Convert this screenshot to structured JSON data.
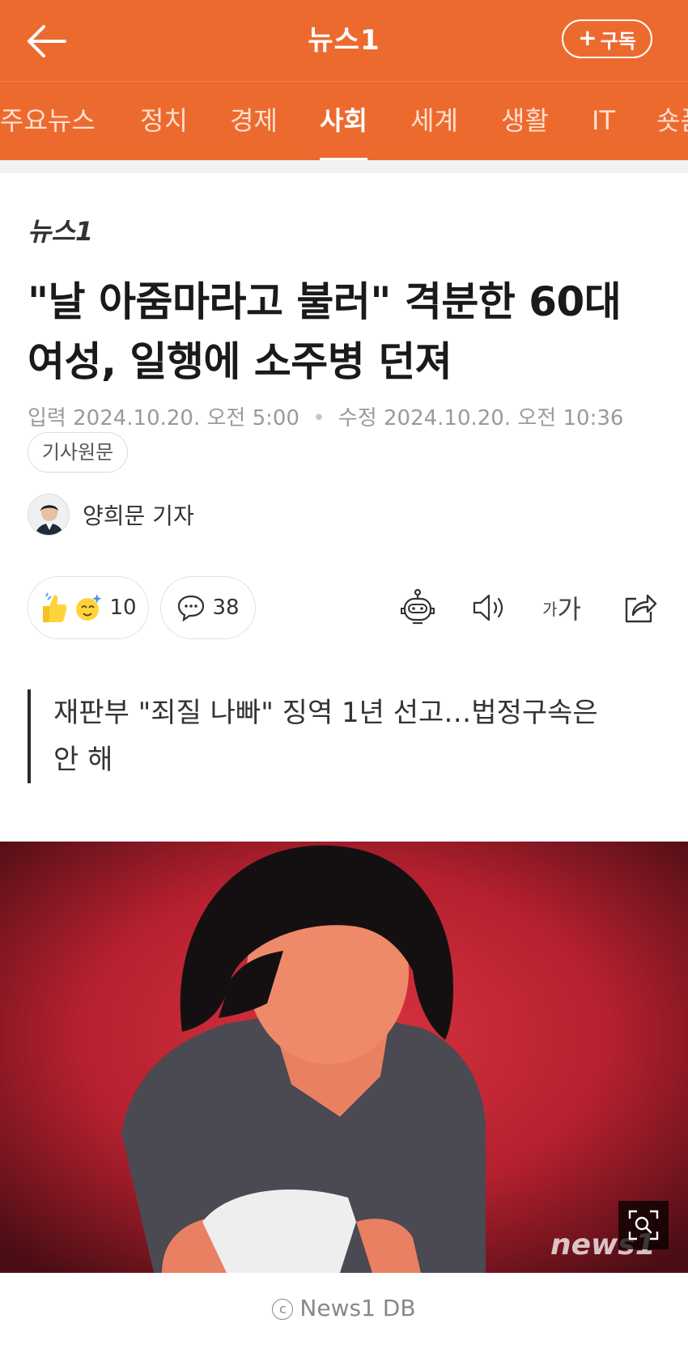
{
  "header": {
    "title": "뉴스1",
    "subscribe_label": "구독"
  },
  "tabs": [
    {
      "label": "주요뉴스"
    },
    {
      "label": "정치"
    },
    {
      "label": "경제"
    },
    {
      "label": "사회"
    },
    {
      "label": "세계"
    },
    {
      "label": "생활"
    },
    {
      "label": "IT"
    },
    {
      "label": "숏폼"
    }
  ],
  "active_tab": "사회",
  "article": {
    "source_logo_text": "뉴스1",
    "headline_line1": "\"날 아줌마라고 불러\" 격분한 60대",
    "headline_line2": "여성, 일행에 소주병 던져",
    "input_label": "입력",
    "input_time": "2024.10.20. 오전 5:00",
    "modified_label": "수정",
    "modified_time": "2024.10.20. 오전 10:36",
    "original_button": "기사원문",
    "reporter": "양희문 기자",
    "reaction_count": "10",
    "comment_count": "38",
    "font_small": "가",
    "font_large": "가",
    "summary_line1": "재판부 \"죄질 나빠\" 징역 1년 선고…법정구속은",
    "summary_line2": "안 해",
    "photo_watermark": "news1",
    "photo_caption": "News1 DB"
  },
  "colors": {
    "brand": "#ed6a2f",
    "photo_background": "#b5202f"
  },
  "icons": [
    "back-arrow-icon",
    "plus-icon",
    "thumbs-up-icon",
    "sparkle-face-icon",
    "comment-icon",
    "robot-icon",
    "speaker-icon",
    "font-size-icon",
    "share-icon",
    "zoom-icon",
    "copyright-icon"
  ]
}
